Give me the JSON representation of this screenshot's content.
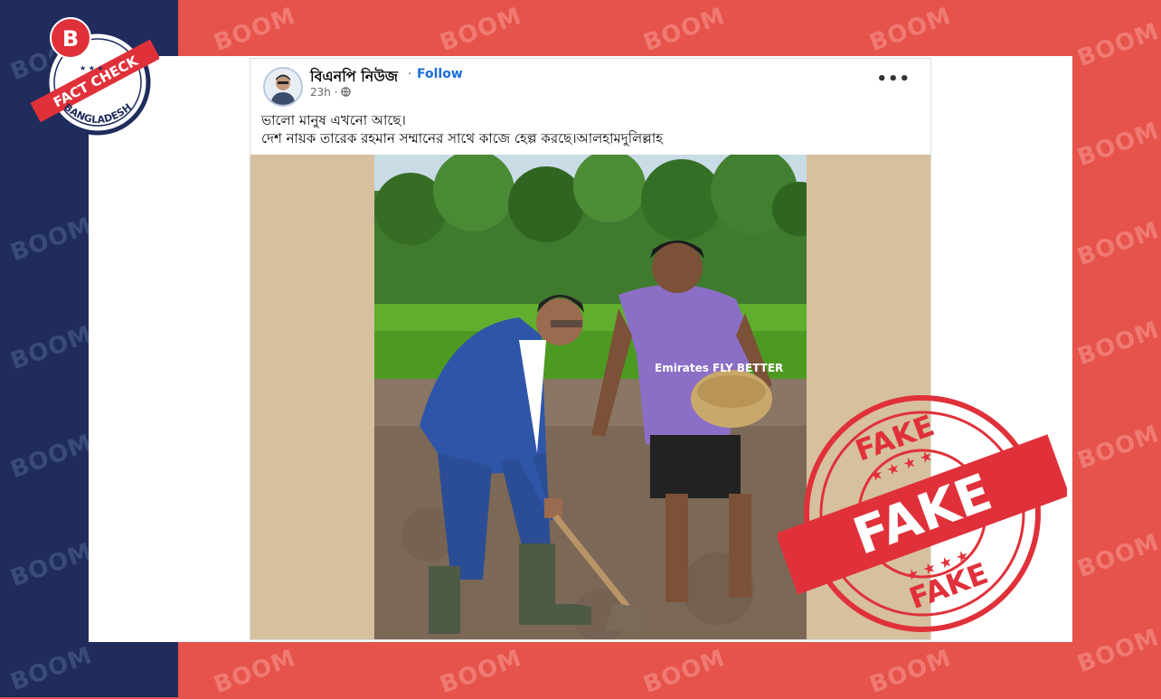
{
  "watermark": "BOOM",
  "logo": {
    "letter": "B",
    "line1": "FACT CHECK",
    "line2": "BANGLADESH"
  },
  "post": {
    "page_name": "বিএনপি নিউজ",
    "follow_label": "Follow",
    "dot_separator": "·",
    "time": "23h",
    "privacy_icon": "globe-icon",
    "more_icon": "more-options-icon",
    "more_label": "•••",
    "text_line1": "ভালো মানুষ এখনো আছে।",
    "text_line2": "দেশ নায়ক তারেক রহমান সম্মানের সাথে কাজে হেল্প করছে।আলহামদুলিল্লাহ",
    "photo": {
      "jersey_sponsor": "Emirates FLY BETTER"
    }
  },
  "stamp": {
    "top_text": "FAKE",
    "center_text": "FAKE",
    "bottom_text": "FAKE"
  },
  "colors": {
    "navy": "#1f2c5c",
    "red": "#e5534b",
    "stamp_red": "#e0313a",
    "facebook_blue": "#1a6ed8"
  }
}
